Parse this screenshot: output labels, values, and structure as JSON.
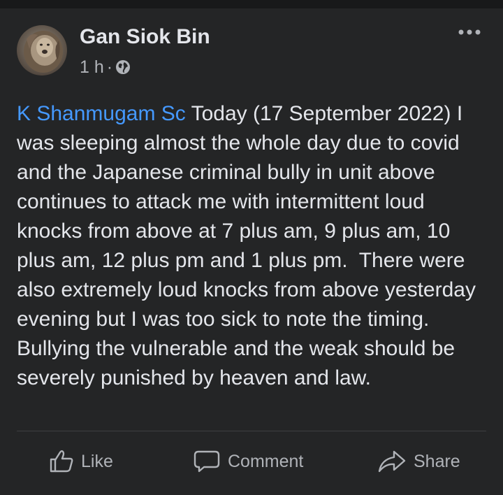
{
  "post": {
    "author": {
      "name": "Gan Siok Bin",
      "avatar_icon": "lion-avatar"
    },
    "meta": {
      "time": "1 h",
      "separator": "·",
      "privacy_icon": "globe-icon"
    },
    "menu_icon": "more-horizontal-icon",
    "mention": "K Shanmugam Sc",
    "text": " Today (17 September 2022) I was sleeping almost the whole day due to covid and the Japanese criminal bully in unit above continues to attack me with intermittent loud knocks from above at 7 plus am, 9 plus am, 10 plus am, 12 plus pm and 1 plus pm.  There were also extremely loud knocks from above yesterday evening but I was too sick to note the timing. Bullying the vulnerable and the weak should be severely punished by heaven and law.",
    "actions": {
      "like": "Like",
      "comment": "Comment",
      "share": "Share"
    }
  },
  "colors": {
    "background": "#18191a",
    "card": "#242526",
    "primary_text": "#e4e6eb",
    "secondary_text": "#b0b3b8",
    "link": "#4599ff",
    "divider": "#3e4042"
  }
}
